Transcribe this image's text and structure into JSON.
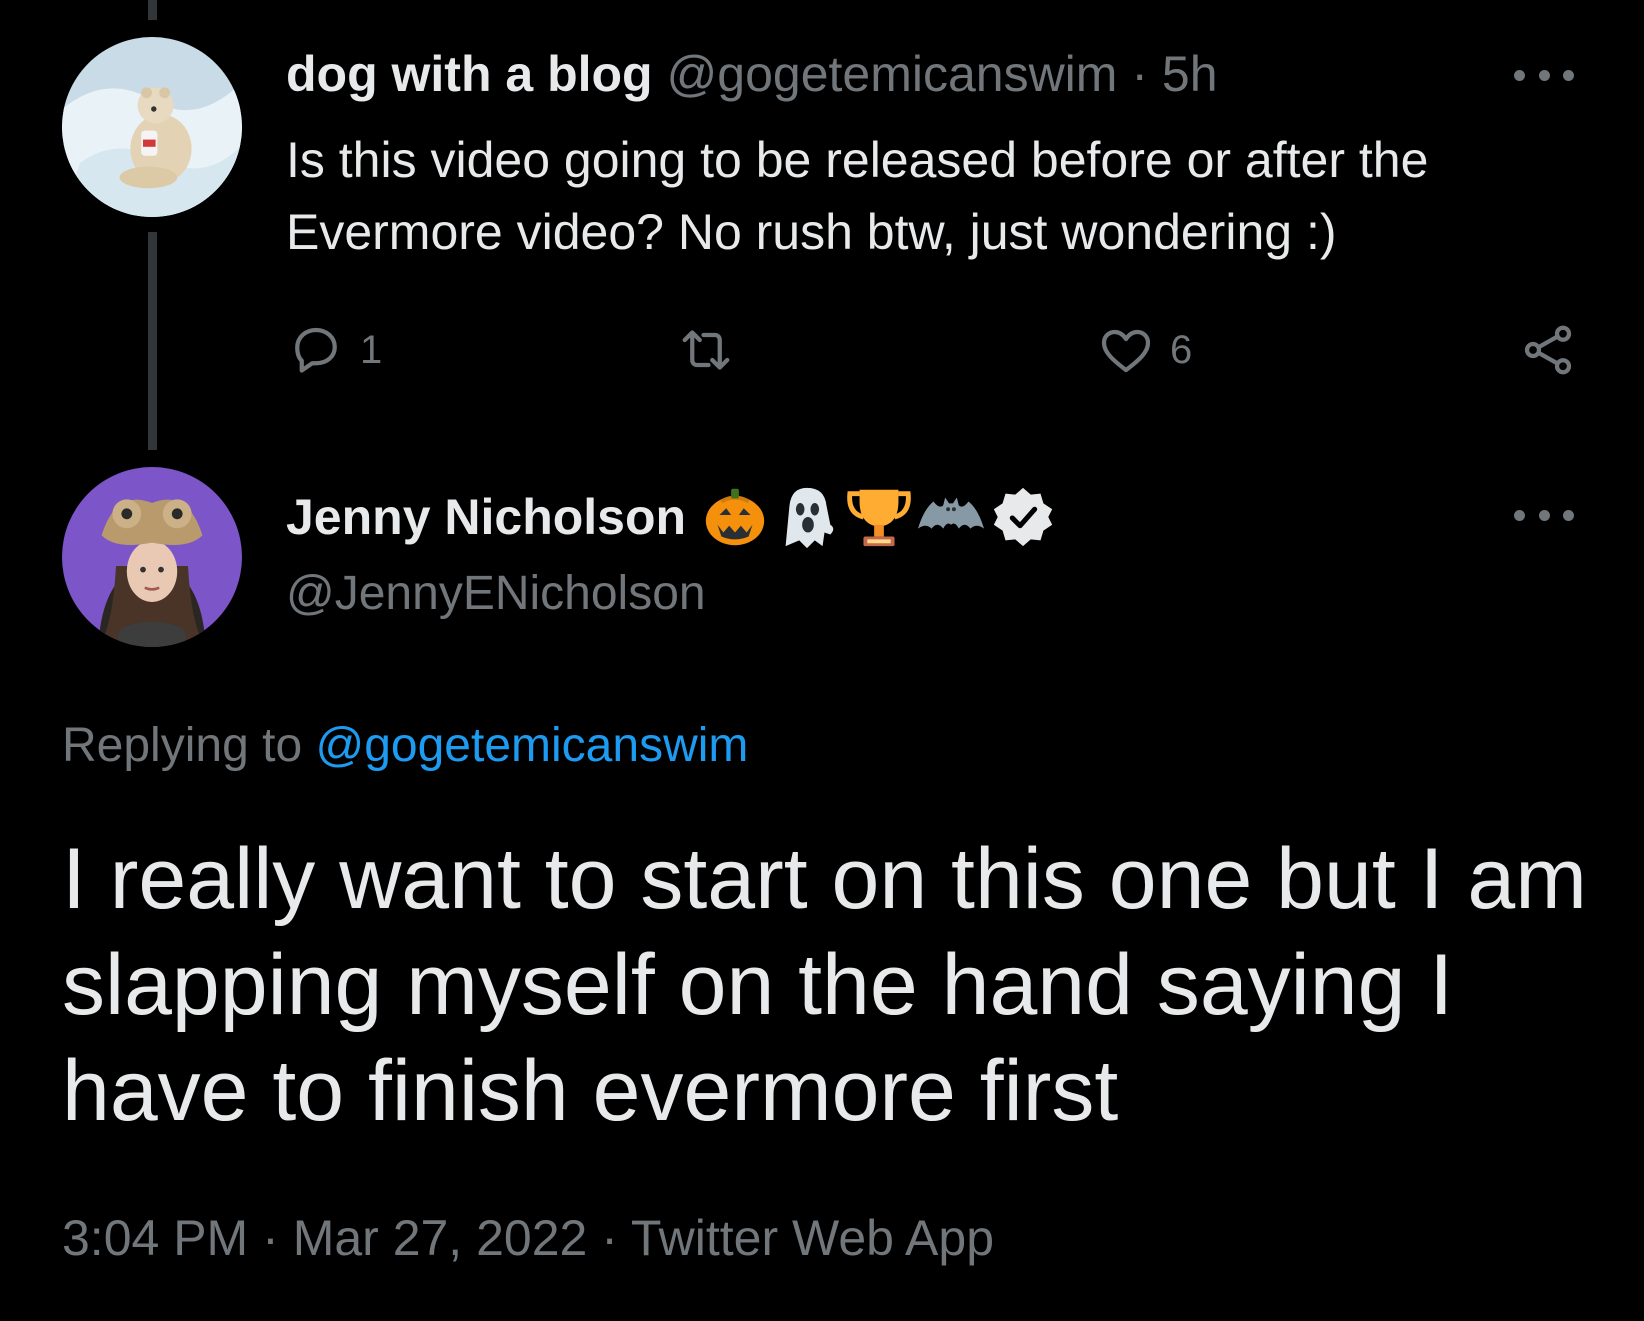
{
  "parent_tweet": {
    "author_name": "dog with a blog",
    "handle": "@gogetemicanswim",
    "separator": "·",
    "time": "5h",
    "text": "Is this video going to be released before or after the Evermore video? No rush btw, just wondering :)",
    "reply_count": "1",
    "like_count": "6",
    "avatar_icon": "polar-bear-avatar"
  },
  "main_tweet": {
    "author_name": "Jenny Nicholson",
    "name_badges": [
      "jack-o-lantern-emoji",
      "ghost-emoji",
      "trophy-emoji",
      "bat-emoji",
      "verified-badge"
    ],
    "handle": "@JennyENicholson",
    "replying_label": "Replying to",
    "replying_to": "@gogetemicanswim",
    "text": "I really want to start on this one but I am slapping myself on the hand saying I have to finish evermore first",
    "time": "3:04 PM",
    "separator": "·",
    "date": "Mar 27, 2022",
    "source": "Twitter Web App",
    "avatar_icon": "profile-photo-avatar"
  },
  "colors": {
    "background": "#000000",
    "text": "#e7e9ea",
    "secondary": "#71767b",
    "link": "#1d9bf0",
    "thread_line": "#333639"
  }
}
